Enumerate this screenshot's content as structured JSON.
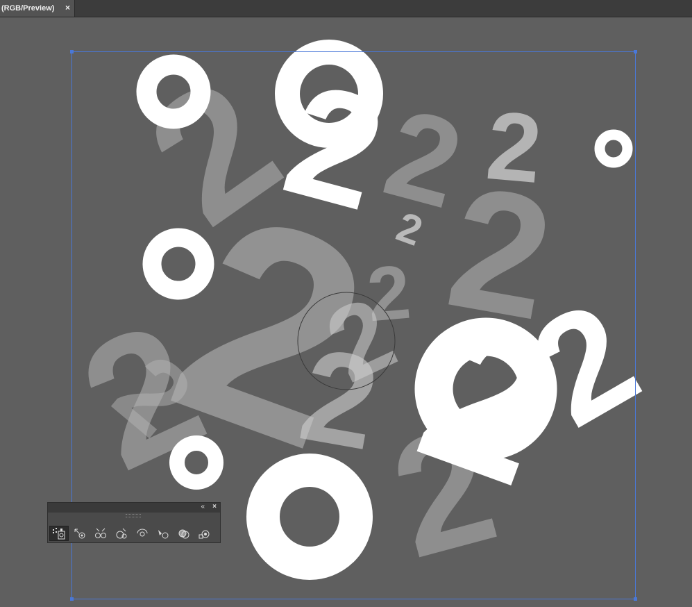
{
  "tab": {
    "title": "(RGB/Preview)",
    "close": "×"
  },
  "panel": {
    "collapse": "«",
    "close": "×"
  },
  "tools": [
    {
      "name": "symbol-sprayer-tool"
    },
    {
      "name": "symbol-shifter-tool"
    },
    {
      "name": "symbol-scruncher-tool"
    },
    {
      "name": "symbol-sizer-tool"
    },
    {
      "name": "symbol-spinner-tool"
    },
    {
      "name": "symbol-stainer-tool"
    },
    {
      "name": "symbol-screener-tool"
    },
    {
      "name": "symbol-styler-tool"
    }
  ],
  "glyph": "2",
  "colors": {
    "canvas": "#5f5f5f",
    "artboard_border": "#4a78d8",
    "symbol_white": "#ffffff",
    "symbol_grey": "#b4b4b4"
  }
}
